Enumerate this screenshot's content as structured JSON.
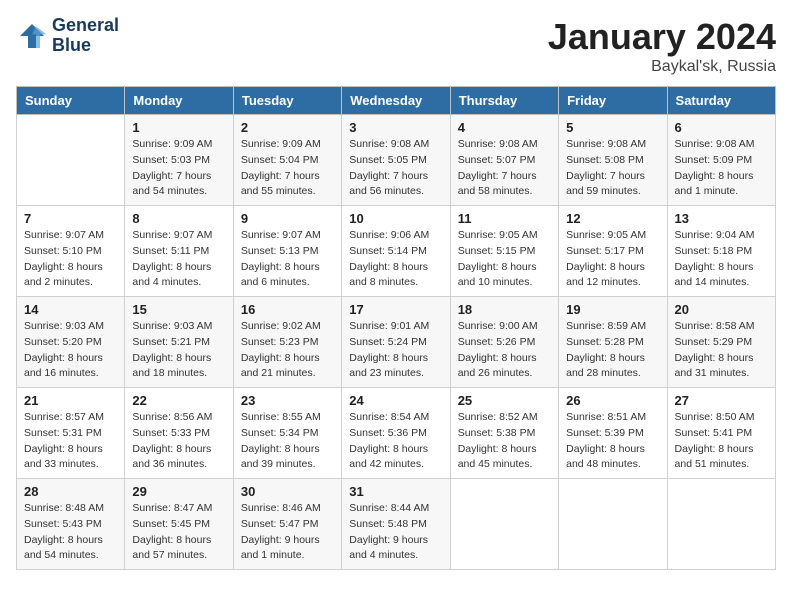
{
  "header": {
    "logo_line1": "General",
    "logo_line2": "Blue",
    "month": "January 2024",
    "location": "Baykal'sk, Russia"
  },
  "weekdays": [
    "Sunday",
    "Monday",
    "Tuesday",
    "Wednesday",
    "Thursday",
    "Friday",
    "Saturday"
  ],
  "weeks": [
    [
      {
        "day": "",
        "info": ""
      },
      {
        "day": "1",
        "info": "Sunrise: 9:09 AM\nSunset: 5:03 PM\nDaylight: 7 hours\nand 54 minutes."
      },
      {
        "day": "2",
        "info": "Sunrise: 9:09 AM\nSunset: 5:04 PM\nDaylight: 7 hours\nand 55 minutes."
      },
      {
        "day": "3",
        "info": "Sunrise: 9:08 AM\nSunset: 5:05 PM\nDaylight: 7 hours\nand 56 minutes."
      },
      {
        "day": "4",
        "info": "Sunrise: 9:08 AM\nSunset: 5:07 PM\nDaylight: 7 hours\nand 58 minutes."
      },
      {
        "day": "5",
        "info": "Sunrise: 9:08 AM\nSunset: 5:08 PM\nDaylight: 7 hours\nand 59 minutes."
      },
      {
        "day": "6",
        "info": "Sunrise: 9:08 AM\nSunset: 5:09 PM\nDaylight: 8 hours\nand 1 minute."
      }
    ],
    [
      {
        "day": "7",
        "info": "Sunrise: 9:07 AM\nSunset: 5:10 PM\nDaylight: 8 hours\nand 2 minutes."
      },
      {
        "day": "8",
        "info": "Sunrise: 9:07 AM\nSunset: 5:11 PM\nDaylight: 8 hours\nand 4 minutes."
      },
      {
        "day": "9",
        "info": "Sunrise: 9:07 AM\nSunset: 5:13 PM\nDaylight: 8 hours\nand 6 minutes."
      },
      {
        "day": "10",
        "info": "Sunrise: 9:06 AM\nSunset: 5:14 PM\nDaylight: 8 hours\nand 8 minutes."
      },
      {
        "day": "11",
        "info": "Sunrise: 9:05 AM\nSunset: 5:15 PM\nDaylight: 8 hours\nand 10 minutes."
      },
      {
        "day": "12",
        "info": "Sunrise: 9:05 AM\nSunset: 5:17 PM\nDaylight: 8 hours\nand 12 minutes."
      },
      {
        "day": "13",
        "info": "Sunrise: 9:04 AM\nSunset: 5:18 PM\nDaylight: 8 hours\nand 14 minutes."
      }
    ],
    [
      {
        "day": "14",
        "info": "Sunrise: 9:03 AM\nSunset: 5:20 PM\nDaylight: 8 hours\nand 16 minutes."
      },
      {
        "day": "15",
        "info": "Sunrise: 9:03 AM\nSunset: 5:21 PM\nDaylight: 8 hours\nand 18 minutes."
      },
      {
        "day": "16",
        "info": "Sunrise: 9:02 AM\nSunset: 5:23 PM\nDaylight: 8 hours\nand 21 minutes."
      },
      {
        "day": "17",
        "info": "Sunrise: 9:01 AM\nSunset: 5:24 PM\nDaylight: 8 hours\nand 23 minutes."
      },
      {
        "day": "18",
        "info": "Sunrise: 9:00 AM\nSunset: 5:26 PM\nDaylight: 8 hours\nand 26 minutes."
      },
      {
        "day": "19",
        "info": "Sunrise: 8:59 AM\nSunset: 5:28 PM\nDaylight: 8 hours\nand 28 minutes."
      },
      {
        "day": "20",
        "info": "Sunrise: 8:58 AM\nSunset: 5:29 PM\nDaylight: 8 hours\nand 31 minutes."
      }
    ],
    [
      {
        "day": "21",
        "info": "Sunrise: 8:57 AM\nSunset: 5:31 PM\nDaylight: 8 hours\nand 33 minutes."
      },
      {
        "day": "22",
        "info": "Sunrise: 8:56 AM\nSunset: 5:33 PM\nDaylight: 8 hours\nand 36 minutes."
      },
      {
        "day": "23",
        "info": "Sunrise: 8:55 AM\nSunset: 5:34 PM\nDaylight: 8 hours\nand 39 minutes."
      },
      {
        "day": "24",
        "info": "Sunrise: 8:54 AM\nSunset: 5:36 PM\nDaylight: 8 hours\nand 42 minutes."
      },
      {
        "day": "25",
        "info": "Sunrise: 8:52 AM\nSunset: 5:38 PM\nDaylight: 8 hours\nand 45 minutes."
      },
      {
        "day": "26",
        "info": "Sunrise: 8:51 AM\nSunset: 5:39 PM\nDaylight: 8 hours\nand 48 minutes."
      },
      {
        "day": "27",
        "info": "Sunrise: 8:50 AM\nSunset: 5:41 PM\nDaylight: 8 hours\nand 51 minutes."
      }
    ],
    [
      {
        "day": "28",
        "info": "Sunrise: 8:48 AM\nSunset: 5:43 PM\nDaylight: 8 hours\nand 54 minutes."
      },
      {
        "day": "29",
        "info": "Sunrise: 8:47 AM\nSunset: 5:45 PM\nDaylight: 8 hours\nand 57 minutes."
      },
      {
        "day": "30",
        "info": "Sunrise: 8:46 AM\nSunset: 5:47 PM\nDaylight: 9 hours\nand 1 minute."
      },
      {
        "day": "31",
        "info": "Sunrise: 8:44 AM\nSunset: 5:48 PM\nDaylight: 9 hours\nand 4 minutes."
      },
      {
        "day": "",
        "info": ""
      },
      {
        "day": "",
        "info": ""
      },
      {
        "day": "",
        "info": ""
      }
    ]
  ]
}
